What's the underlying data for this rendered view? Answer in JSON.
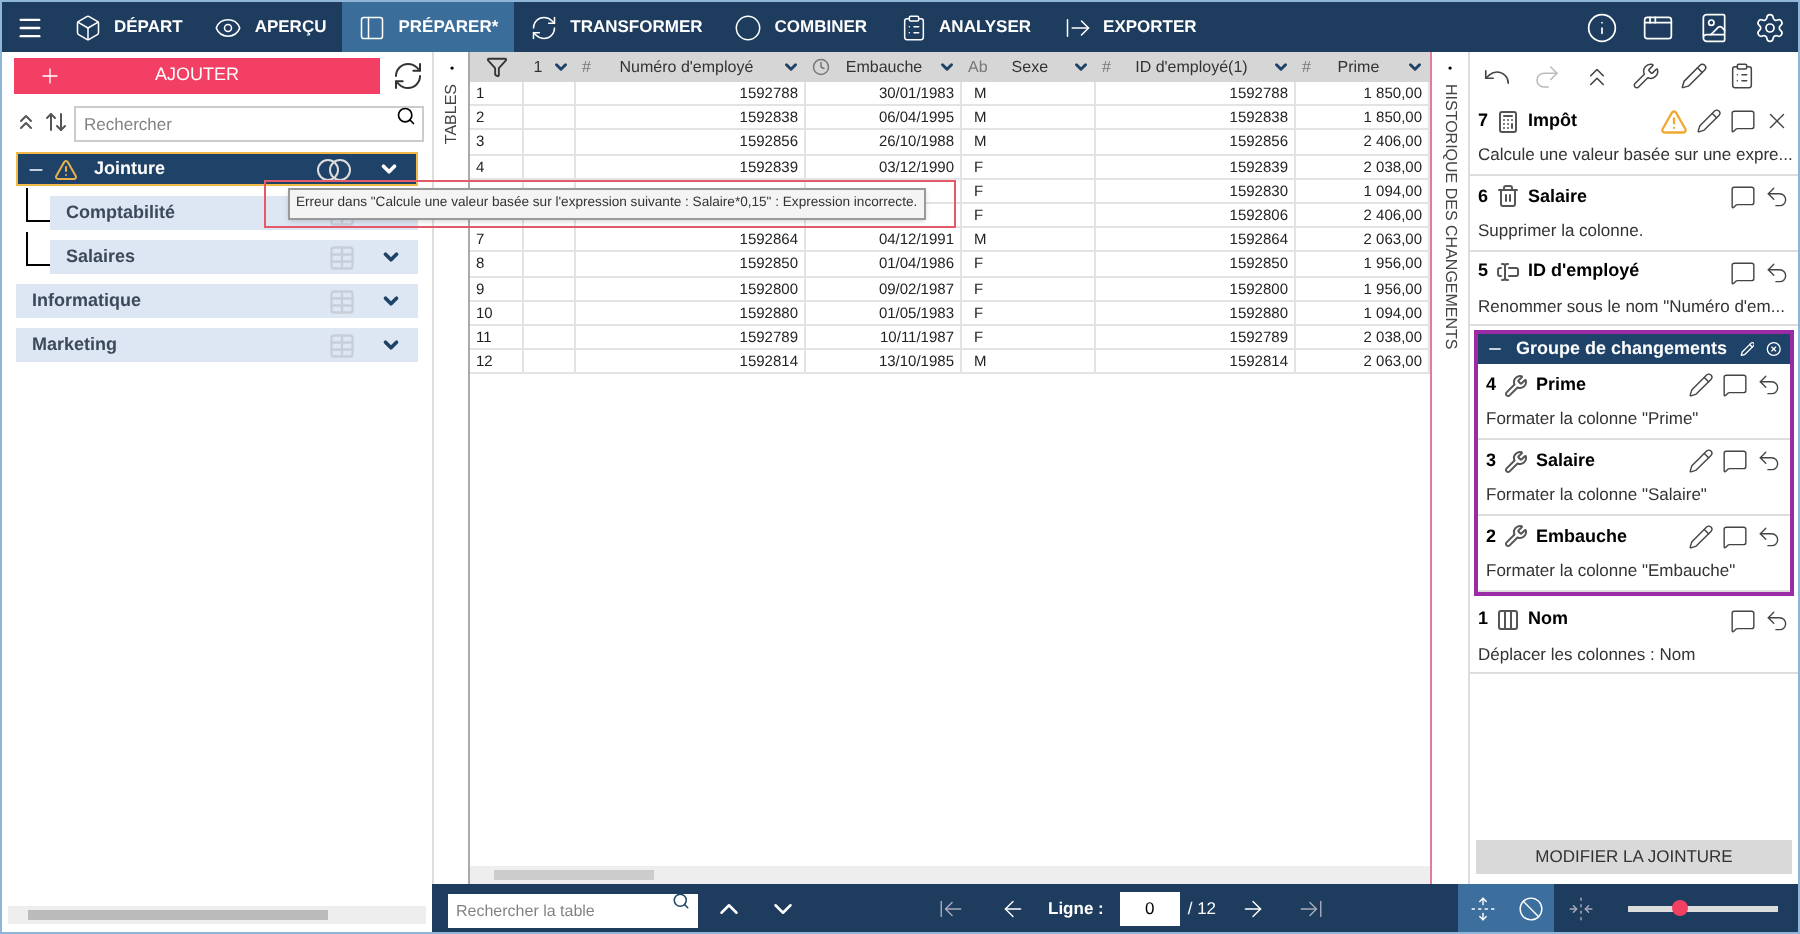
{
  "menu": [
    {
      "label": "DÉPART",
      "kind": "home",
      "selected": false
    },
    {
      "label": "APERÇU",
      "kind": "preview",
      "selected": false
    },
    {
      "label": "PRÉPARER*",
      "kind": "prepare",
      "selected": true
    },
    {
      "label": "TRANSFORMER",
      "kind": "transform",
      "selected": false
    },
    {
      "label": "COMBINER",
      "kind": "combine",
      "selected": false
    },
    {
      "label": "ANALYSER",
      "kind": "analyze",
      "selected": false
    },
    {
      "label": "EXPORTER",
      "kind": "export",
      "selected": false
    }
  ],
  "left": {
    "add_button": "AJOUTER",
    "search": {
      "placeholder": "Rechercher"
    },
    "tables": [
      {
        "name": "Jointure",
        "kind": "join",
        "selected": true,
        "warning": true,
        "expanded": true,
        "children": [
          {
            "name": "Comptabilité",
            "kind": "table",
            "selected": false,
            "warning": false
          },
          {
            "name": "Salaires",
            "kind": "table",
            "selected": false,
            "warning": false
          }
        ]
      },
      {
        "name": "Informatique",
        "kind": "table",
        "selected": false,
        "warning": false
      },
      {
        "name": "Marketing",
        "kind": "table",
        "selected": false,
        "warning": false
      }
    ]
  },
  "side_tabs": {
    "tables": "TABLES",
    "history": "HISTORIQUE DES CHANGEMENTS"
  },
  "tooltip": "Erreur dans \"Calcule une valeur basée sur l'expression suivante : Salaire*0,15\" : Expression incorrecte.",
  "table": {
    "columns": [
      {
        "kind": "plain",
        "label": "1"
      },
      {
        "kind": "number",
        "type_label": "#",
        "label": "Numéro d'employé"
      },
      {
        "kind": "date",
        "label": "Embauche"
      },
      {
        "kind": "text",
        "type_label": "Ab",
        "label": "Sexe"
      },
      {
        "kind": "number",
        "type_label": "#",
        "label": "ID d'employé(1)"
      },
      {
        "kind": "number",
        "type_label": "#",
        "label": "Prime"
      }
    ],
    "rows": [
      {
        "number": "1",
        "cells": [
          "",
          "1592788",
          "30/01/1983",
          "M",
          "1592788",
          "1 850,00"
        ]
      },
      {
        "number": "2",
        "cells": [
          "",
          "1592838",
          "06/04/1995",
          "M",
          "1592838",
          "1 850,00"
        ]
      },
      {
        "number": "3",
        "cells": [
          "",
          "1592856",
          "26/10/1988",
          "M",
          "1592856",
          "2 406,00"
        ]
      },
      {
        "number": "4",
        "cells": [
          "",
          "1592839",
          "03/12/1990",
          "F",
          "1592839",
          "2 038,00"
        ]
      },
      {
        "number": null,
        "cells": [
          "",
          null,
          null,
          "F",
          "1592830",
          "1 094,00"
        ]
      },
      {
        "number": null,
        "cells": [
          "",
          null,
          null,
          "F",
          "1592806",
          "2 406,00"
        ]
      },
      {
        "number": "7",
        "cells": [
          "",
          "1592864",
          "04/12/1991",
          "M",
          "1592864",
          "2 063,00"
        ]
      },
      {
        "number": "8",
        "cells": [
          "",
          "1592850",
          "01/04/1986",
          "F",
          "1592850",
          "1 956,00"
        ]
      },
      {
        "number": "9",
        "cells": [
          "",
          "1592800",
          "09/02/1987",
          "F",
          "1592800",
          "1 956,00"
        ]
      },
      {
        "number": "10",
        "cells": [
          "",
          "1592880",
          "01/05/1983",
          "F",
          "1592880",
          "1 094,00"
        ]
      },
      {
        "number": "11",
        "cells": [
          "",
          "1592789",
          "10/11/1987",
          "F",
          "1592789",
          "2 038,00"
        ]
      },
      {
        "number": "12",
        "cells": [
          "",
          "1592814",
          "13/10/1985",
          "M",
          "1592814",
          "2 063,00"
        ]
      }
    ]
  },
  "history": {
    "items": [
      {
        "kind": "formula",
        "number": "7",
        "title": "Impôt",
        "description": "Calcule une valeur basée sur une expre...",
        "warning": true,
        "editable": true,
        "undoable": false
      },
      {
        "kind": "delete",
        "number": "6",
        "title": "Salaire",
        "description": "Supprimer la colonne.",
        "warning": false,
        "editable": false,
        "undoable": true
      },
      {
        "kind": "rename",
        "number": "5",
        "title": "ID d'employé",
        "description": "Renommer sous le nom \"Numéro d'em...",
        "warning": false,
        "editable": false,
        "undoable": true
      },
      {
        "kind": "group",
        "title": "Groupe de changements",
        "expanded": true,
        "items": [
          {
            "kind": "format",
            "number": "4",
            "title": "Prime",
            "description": "Formater la colonne \"Prime\"",
            "warning": false,
            "editable": true,
            "undoable": true
          },
          {
            "kind": "format",
            "number": "3",
            "title": "Salaire",
            "description": "Formater la colonne \"Salaire\"",
            "warning": false,
            "editable": true,
            "undoable": true
          },
          {
            "kind": "format",
            "number": "2",
            "title": "Embauche",
            "description": "Formater la colonne \"Embauche\"",
            "warning": false,
            "editable": true,
            "undoable": true
          }
        ]
      },
      {
        "kind": "move",
        "number": "1",
        "title": "Nom",
        "description": "Déplacer les colonnes : Nom",
        "warning": false,
        "editable": false,
        "undoable": true
      }
    ],
    "button": "MODIFIER LA JOINTURE"
  },
  "footer": {
    "search": {
      "placeholder": "Rechercher la table"
    },
    "row_label": "Ligne :",
    "row_value": "0",
    "row_total": "/ 12",
    "fit_rows": true,
    "hide_nulls": true,
    "zoom": {
      "level": 0.35
    }
  }
}
